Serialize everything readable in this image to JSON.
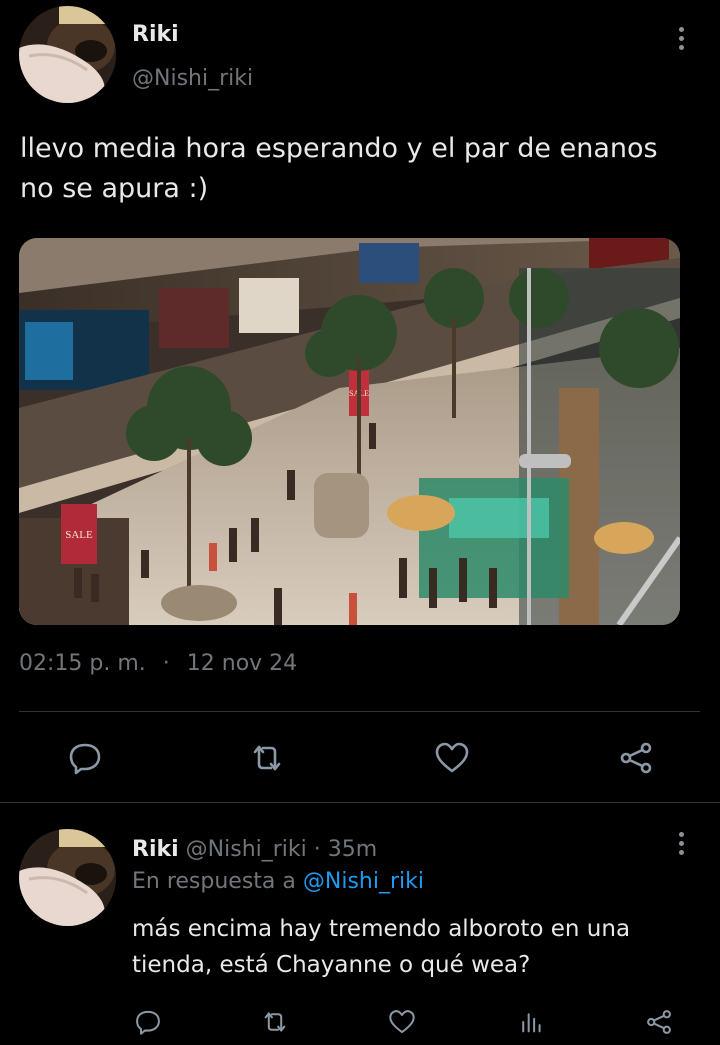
{
  "colors": {
    "background": "#000000",
    "text": "#e7e9ea",
    "muted": "#71767b",
    "accent": "#1d9bf0",
    "divider": "#2f3336"
  },
  "main_tweet": {
    "author_name": "Riki",
    "author_handle": "@Nishi_riki",
    "text_line1": "llevo media hora esperando y el par de enanos",
    "text_line2": "no se apura :)",
    "time": "02:15 p. m.",
    "separator": "·",
    "date": "12 nov 24",
    "photo_signs": {
      "sign1": "SALE",
      "sign2": "SALE"
    },
    "actions": [
      "reply-icon",
      "retweet-icon",
      "like-icon",
      "share-icon"
    ]
  },
  "reply": {
    "author_name": "Riki",
    "author_handle": "@Nishi_riki",
    "age_separator": "·",
    "age": "35m",
    "replying_prefix": "En respuesta a",
    "replying_to": "@Nishi_riki",
    "text_line1": "más encima hay tremendo alboroto en una",
    "text_line2": "tienda, está Chayanne o qué wea?",
    "actions": [
      "reply-icon",
      "retweet-icon",
      "like-icon",
      "views-icon",
      "share-icon"
    ]
  }
}
